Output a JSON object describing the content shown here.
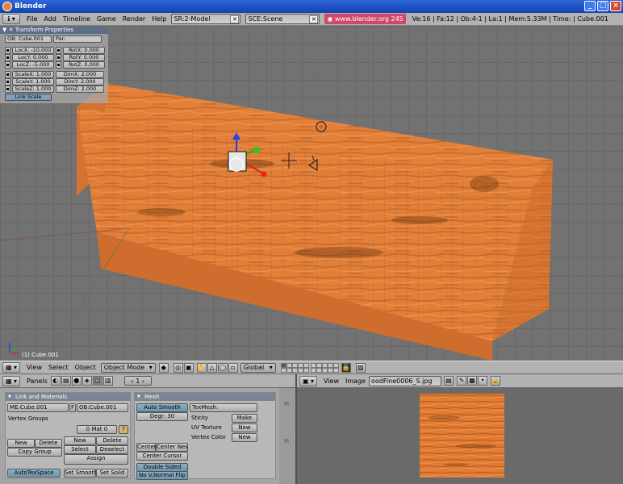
{
  "window": {
    "title": "Blender"
  },
  "header": {
    "menus": [
      "File",
      "Add",
      "Timeline",
      "Game",
      "Render",
      "Help"
    ],
    "screen_field": "SR:2-Model",
    "scene_field": "SCE:Scene",
    "url": "www.blender.org 245",
    "status": "Ve:16 | Fa:12 | Ob:4-1 | La:1  | Mem:5.33M | Time: | Cube.001"
  },
  "transform": {
    "title": "Transform Properties",
    "ob": "OB: Cube.001",
    "par": "Par:",
    "loc": [
      "LocX: -10.000",
      "LocY: 0.000",
      "LocZ: -5.000"
    ],
    "rot": [
      "RotX: 0.000",
      "RotY: 0.000",
      "RotZ: 0.000"
    ],
    "scale": [
      "ScaleX: 1.000",
      "ScaleY: 1.000",
      "ScaleZ: 1.000"
    ],
    "dim": [
      "DimX: 2.000",
      "DimY: 2.000",
      "DimZ: 2.000"
    ],
    "link_scale": "Link Scale"
  },
  "viewport": {
    "object_label": "(1) Cube.001"
  },
  "view_header": {
    "menus": [
      "View",
      "Select",
      "Object"
    ],
    "mode": "Object Mode",
    "orientation": "Global"
  },
  "buttons": {
    "panels_label": "Panels",
    "frame": "1",
    "link_panel": {
      "title": "Link and Materials",
      "me": "ME:Cube.001",
      "f": "F",
      "ob": "OB:Cube.001",
      "vertex_groups": "Vertex Groups",
      "mat": "0 Mat 0",
      "q": "?",
      "new": "New",
      "delete": "Delete",
      "copy_group": "Copy Group",
      "new2": "New",
      "delete2": "Delete",
      "select": "Select",
      "deselect": "Deselect",
      "assign": "Assign",
      "autotexspace": "AutoTexSpace",
      "set_smooth": "Set Smooth",
      "set_solid": "Set Solid"
    },
    "mesh_panel": {
      "title": "Mesh",
      "auto_smooth": "Auto Smooth",
      "degr": "Degr: 30",
      "texmesh": "TexMesh:",
      "sticky": "Sticky",
      "make": "Make",
      "uv_texture": "UV Texture",
      "new_uv": "New",
      "vertex_color": "Vertex Color",
      "new_vc": "New",
      "center": "Center",
      "center_new": "Center New",
      "center_cursor": "Center Cursor",
      "double_sided": "Double Sided",
      "no_vnormal_flip": "No V.Normal Flip"
    },
    "scroll_marks": [
      "M",
      "M"
    ]
  },
  "image_window": {
    "menus": [
      "View",
      "Image"
    ],
    "image_name": "oodFine0006_S.jpg"
  },
  "colors": {
    "wood_light": "#e8843a",
    "wood_dark": "#b85a1c",
    "panel_header": "#5c6e84"
  }
}
